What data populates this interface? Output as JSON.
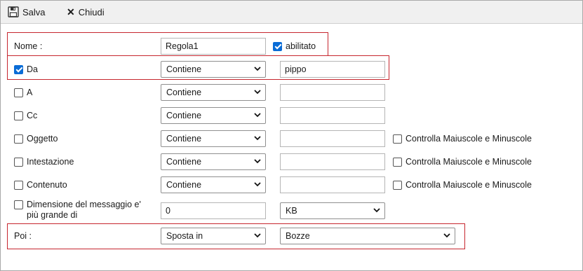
{
  "toolbar": {
    "save_label": "Salva",
    "close_label": "Chiudi"
  },
  "form": {
    "name_label": "Nome :",
    "name_value": "Regola1",
    "enabled_label": "abilitato",
    "enabled": true,
    "from": {
      "label": "Da",
      "checked": true,
      "op": "Contiene",
      "value": "pippo"
    },
    "to": {
      "label": "A",
      "checked": false,
      "op": "Contiene",
      "value": ""
    },
    "cc": {
      "label": "Cc",
      "checked": false,
      "op": "Contiene",
      "value": ""
    },
    "subject": {
      "label": "Oggetto",
      "checked": false,
      "op": "Contiene",
      "value": "",
      "case_label": "Controlla Maiuscole e Minuscole",
      "case_checked": false
    },
    "header": {
      "label": "Intestazione",
      "checked": false,
      "op": "Contiene",
      "value": "",
      "case_label": "Controlla Maiuscole e Minuscole",
      "case_checked": false
    },
    "content": {
      "label": "Contenuto",
      "checked": false,
      "op": "Contiene",
      "value": "",
      "case_label": "Controlla Maiuscole e Minuscole",
      "case_checked": false
    },
    "size": {
      "label_line1": "Dimensione del messaggio e'",
      "label_line2": "più grande di",
      "checked": false,
      "value": "0",
      "unit": "KB"
    },
    "then": {
      "label": "Poi :",
      "action": "Sposta in",
      "folder": "Bozze"
    }
  },
  "colors": {
    "highlight": "#c6262e",
    "checkbox_accent": "#0a6cd6",
    "toolbar_bg": "#f0f0f0"
  }
}
